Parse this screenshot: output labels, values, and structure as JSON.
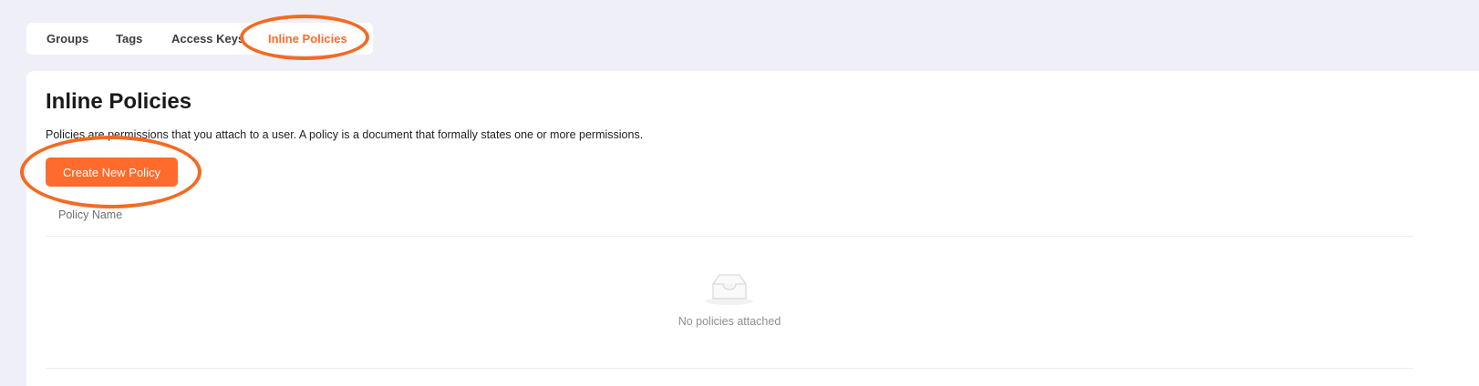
{
  "tabs": [
    {
      "label": "Groups",
      "active": false
    },
    {
      "label": "Tags",
      "active": false
    },
    {
      "label": "Access Keys",
      "active": false
    },
    {
      "label": "Inline Policies",
      "active": true
    }
  ],
  "main": {
    "title": "Inline Policies",
    "description": "Policies are permissions that you attach to a user. A policy is a document that formally states one or more permissions.",
    "create_button_label": "Create New Policy",
    "table": {
      "columns": [
        "Policy Name"
      ],
      "rows": [],
      "empty_message": "No policies attached",
      "empty_icon": "empty-inbox-icon"
    }
  },
  "colors": {
    "accent": "#ff6b2c",
    "annotation": "#f26b22",
    "background": "#eff0f7"
  }
}
